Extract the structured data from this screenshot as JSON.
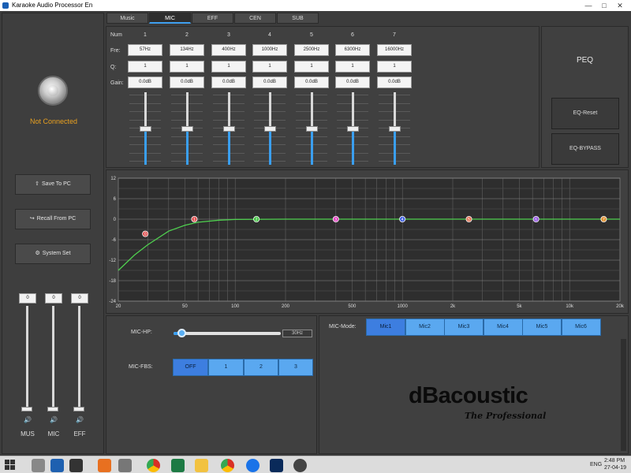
{
  "window": {
    "title": "Karaoke Audio Processor En",
    "minimize": "—",
    "maximize": "□",
    "close": "✕"
  },
  "status": {
    "connection": "Not Connected",
    "color": "#e8a020"
  },
  "sidebar": {
    "buttons": [
      {
        "icon": "⇧",
        "label": "Save To PC"
      },
      {
        "icon": "↪",
        "label": "Recall From PC"
      },
      {
        "icon": "⚙",
        "label": "System Set"
      }
    ],
    "channels": [
      {
        "name": "MUS",
        "value": "0",
        "level": 0.0
      },
      {
        "name": "MIC",
        "value": "0",
        "level": 0.0
      },
      {
        "name": "EFF",
        "value": "0",
        "level": 0.0
      }
    ]
  },
  "tabs": [
    "Music",
    "MIC",
    "EFF",
    "CEN",
    "SUB"
  ],
  "active_tab": 1,
  "peq": {
    "title": "PEQ",
    "row_labels": {
      "num": "Num",
      "freq": "Fre:",
      "q": "Q:",
      "gain": "Gain:"
    },
    "bands": [
      {
        "num": "1",
        "freq": "57Hz",
        "q": "1",
        "gain": "0.0dB"
      },
      {
        "num": "2",
        "freq": "134Hz",
        "q": "1",
        "gain": "0.0dB"
      },
      {
        "num": "3",
        "freq": "400Hz",
        "q": "1",
        "gain": "0.0dB"
      },
      {
        "num": "4",
        "freq": "1000Hz",
        "q": "1",
        "gain": "0.0dB"
      },
      {
        "num": "5",
        "freq": "2500Hz",
        "q": "1",
        "gain": "0.0dB"
      },
      {
        "num": "6",
        "freq": "6300Hz",
        "q": "1",
        "gain": "0.0dB"
      },
      {
        "num": "7",
        "freq": "16000Hz",
        "q": "1",
        "gain": "0.0dB"
      }
    ],
    "reset_label": "EQ-Reset",
    "bypass_label": "EQ-BYPASS"
  },
  "chart_data": {
    "type": "line",
    "xscale": "log",
    "xlim": [
      20,
      20000
    ],
    "ylim": [
      -24,
      12
    ],
    "yticks": [
      "12",
      "6",
      "0",
      "-6",
      "-12",
      "-18",
      "-24"
    ],
    "xticks": [
      "20",
      "50",
      "100",
      "200",
      "500",
      "1000",
      "2k",
      "5k",
      "10k",
      "20k"
    ],
    "grid": true,
    "curve_color": "#4fd04f",
    "series": [
      {
        "x": [
          20,
          25,
          30,
          40,
          50,
          60,
          80,
          100,
          200,
          500,
          1000,
          2000,
          5000,
          10000,
          20000
        ],
        "y": [
          -15,
          -10.5,
          -7.5,
          -3.5,
          -1.8,
          -0.9,
          -0.3,
          -0.1,
          0,
          0,
          0,
          0,
          0,
          0,
          0
        ]
      }
    ],
    "markers": [
      {
        "label": "0",
        "x": 29,
        "y": -4.3,
        "color": "#e05050"
      },
      {
        "label": "1",
        "x": 57,
        "y": 0,
        "color": "#e05050"
      },
      {
        "label": "2",
        "x": 134,
        "y": 0,
        "color": "#40c040"
      },
      {
        "label": "3",
        "x": 400,
        "y": 0,
        "color": "#e040c0"
      },
      {
        "label": "4",
        "x": 1000,
        "y": 0,
        "color": "#4060e0"
      },
      {
        "label": "5",
        "x": 2500,
        "y": 0,
        "color": "#e07050"
      },
      {
        "label": "6",
        "x": 6300,
        "y": 0,
        "color": "#9050e0"
      },
      {
        "label": "7",
        "x": 16000,
        "y": 0,
        "color": "#e09030"
      }
    ]
  },
  "mic": {
    "hp_label": "MIC-HP:",
    "hp_value": "30Hz",
    "hp_level": 0.05,
    "fbs_label": "MIC-FBS:",
    "fbs_options": [
      "OFF",
      "1",
      "2",
      "3"
    ],
    "fbs_selected": 0,
    "mode_label": "MIC-Mode:",
    "mode_options": [
      "Mic1",
      "Mic2",
      "Mic3",
      "Mic4",
      "Mic5",
      "Mic6"
    ],
    "mode_selected": 0
  },
  "brand": {
    "name": "dBacoustic",
    "tagline": "The Professional"
  },
  "taskbar": {
    "lang": "ENG",
    "time": "2:48 PM",
    "date": "27-04-19",
    "apps": [
      "chrome-icon",
      "excel-icon",
      "explorer-icon",
      "zalo-icon",
      "photoshop-icon"
    ]
  }
}
